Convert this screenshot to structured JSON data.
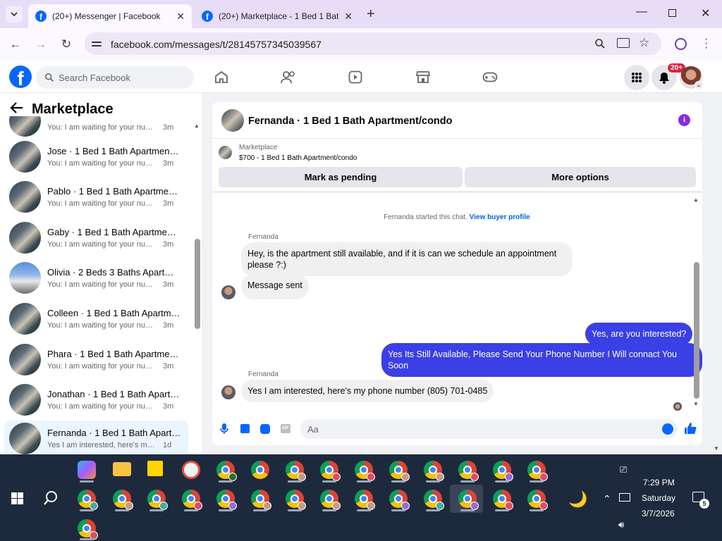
{
  "browser": {
    "tabs": [
      {
        "title": "(20+) Messenger | Facebook",
        "active": true
      },
      {
        "title": "(20+) Marketplace - 1 Bed 1 Bath",
        "active": false
      }
    ],
    "url": "facebook.com/messages/t/28145757345039567"
  },
  "fb": {
    "search_placeholder": "Search Facebook",
    "notif_badge": "20+"
  },
  "left": {
    "title": "Marketplace",
    "conversations": [
      {
        "name": "",
        "msg": "You: I am waiting for your number...",
        "time": "3m"
      },
      {
        "name": "Jose · 1 Bed 1 Bath Apartment/c...",
        "msg": "You: I am waiting for your number...",
        "time": "3m"
      },
      {
        "name": "Pablo · 1 Bed 1 Bath Apartment/...",
        "msg": "You: I am waiting for your number...",
        "time": "3m"
      },
      {
        "name": "Gaby · 1 Bed 1 Bath Apartment/...",
        "msg": "You: I am waiting for your number...",
        "time": "3m"
      },
      {
        "name": "Olivia · 2 Beds 3 Baths Apartme...",
        "msg": "You: I am waiting for your number...",
        "time": "3m"
      },
      {
        "name": "Colleen · 1 Bed 1 Bath Apartmen...",
        "msg": "You: I am waiting for your number...",
        "time": "3m"
      },
      {
        "name": "Phara · 1 Bed 1 Bath Apartment/...",
        "msg": "You: I am waiting for your number...",
        "time": "3m"
      },
      {
        "name": "Jonathan · 1 Bed 1 Bath Apartm...",
        "msg": "You: I am waiting for your number...",
        "time": "3m"
      },
      {
        "name": "Fernanda · 1 Bed 1 Bath Apartm...",
        "msg": "Yes I am interested, here's my pho...",
        "time": "1d"
      }
    ]
  },
  "chat": {
    "title": "Fernanda · 1 Bed 1 Bath Apartment/condo",
    "listing_source": "Marketplace",
    "listing_detail": "$700 - 1 Bed 1 Bath Apartment/condo",
    "mark_pending": "Mark as pending",
    "more_options": "More options",
    "started_text": "Fernanda started this chat.",
    "view_profile": "View buyer profile",
    "sender": "Fernanda",
    "msg1": "Hey, is the apartment still available, and if it is can we schedule an appointment please ?:)",
    "msg2": "Message sent",
    "msg3": "Yes, are you interested?",
    "msg4": "Yes Its Still Available, Please Send Your Phone Number I Will connact You Soon",
    "msg5": "Yes I am interested, here's my phone number (805) 701-0485",
    "composer_placeholder": "Aa"
  },
  "taskbar": {
    "time": "7:29 PM",
    "day": "Saturday",
    "date": "3/7/2026",
    "notif_count": "5"
  }
}
